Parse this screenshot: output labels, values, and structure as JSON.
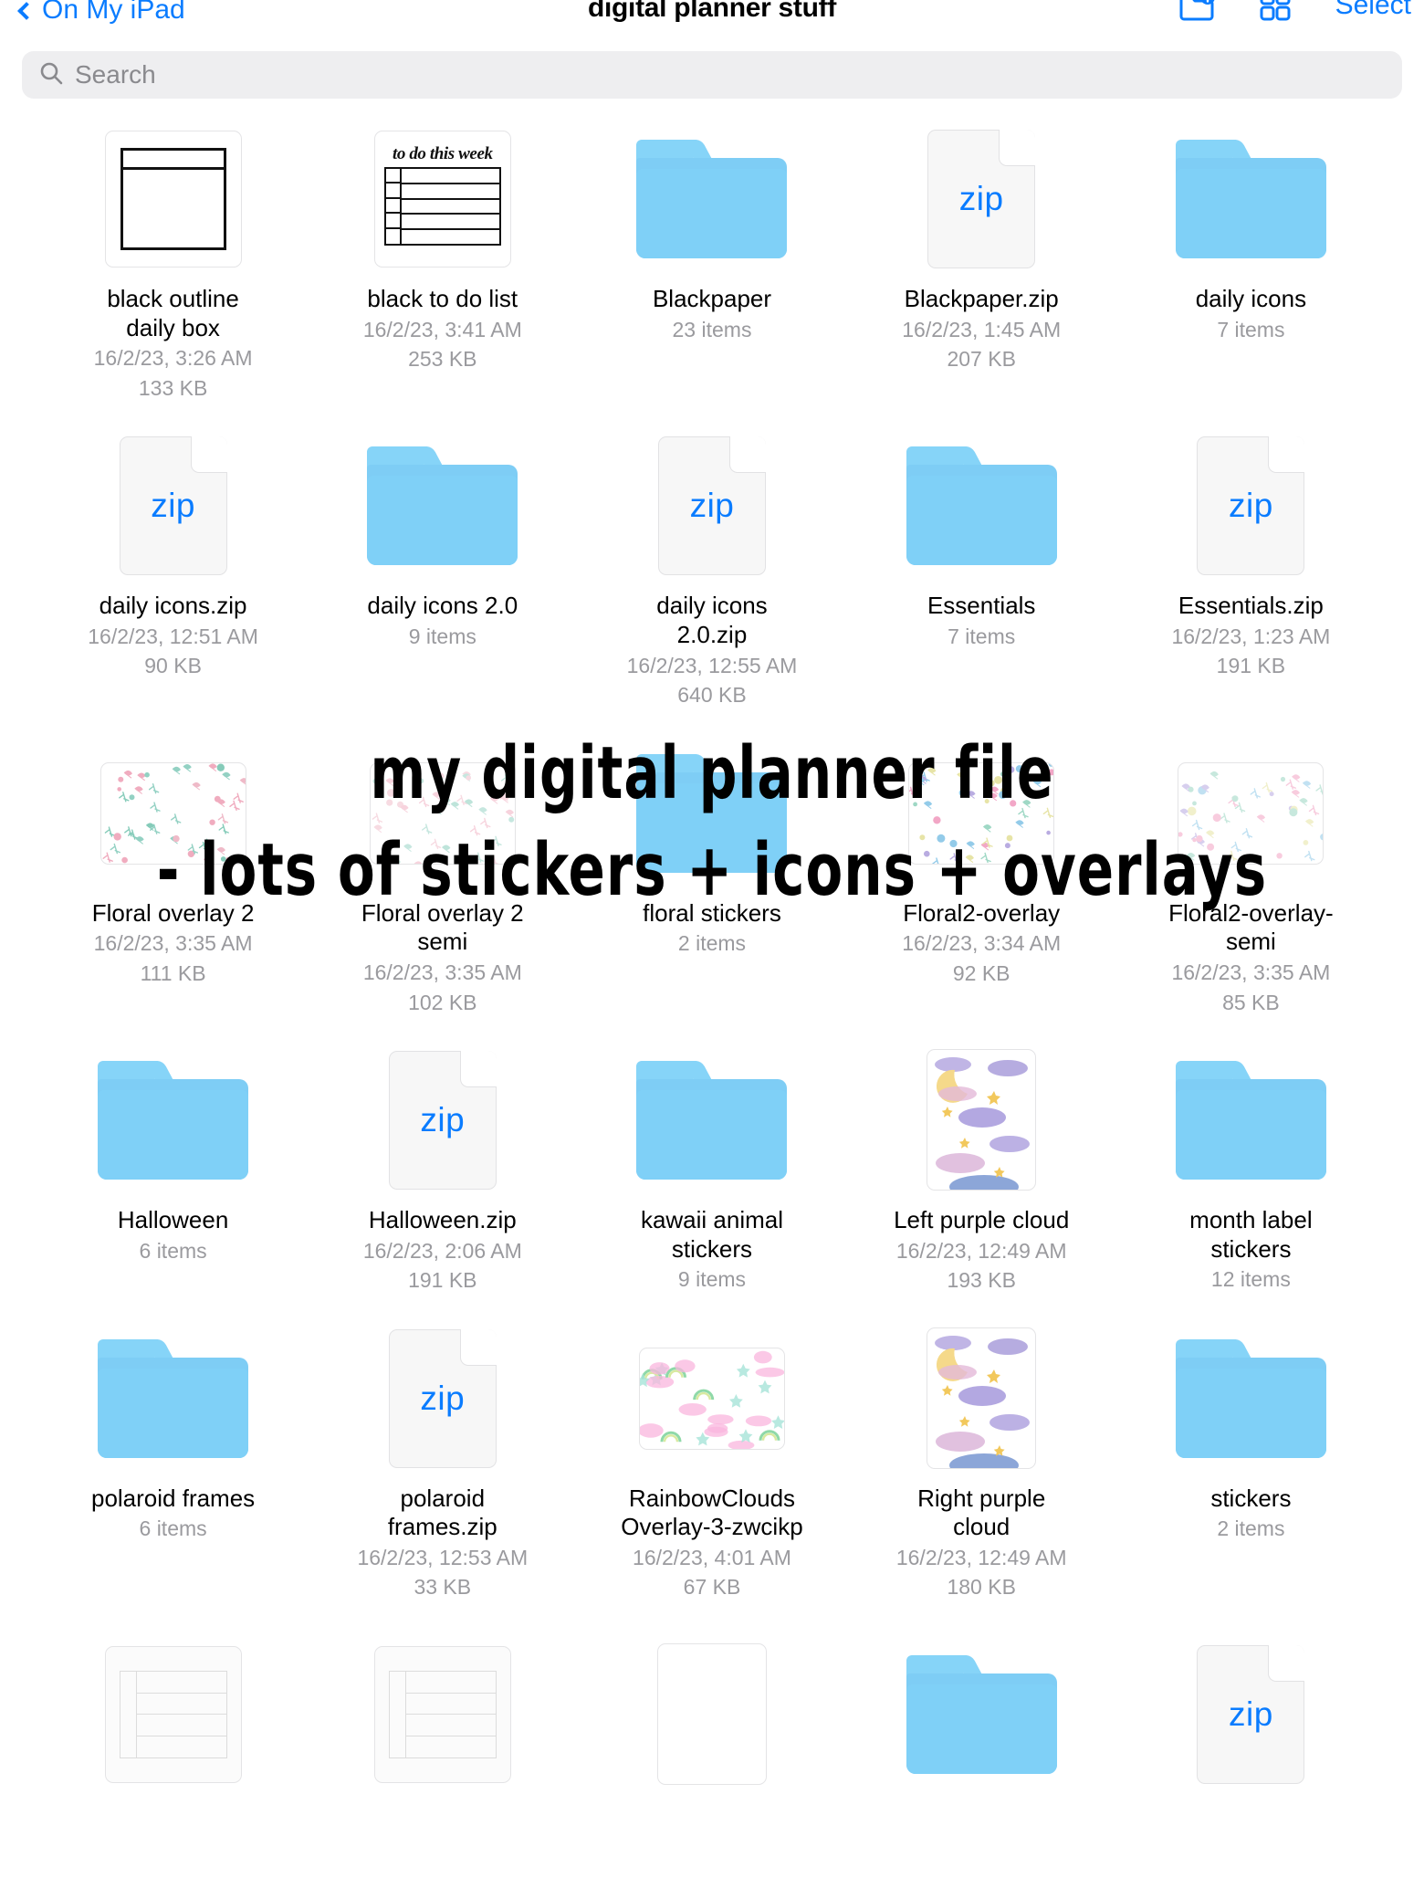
{
  "navbar": {
    "back_label": "On My iPad",
    "title": "digital planner stuff",
    "select_label": "Select",
    "new_folder_icon": "new-folder-icon",
    "grid_view_icon": "grid-view-icon",
    "accent_color": "#0a7cff"
  },
  "search": {
    "placeholder": "Search",
    "value": "",
    "icon": "search-icon"
  },
  "annotation": {
    "line1": "my digital planner file",
    "line2": "- lots of stickers + icons + overlays"
  },
  "colors": {
    "folder_blue": "#7fd0f7",
    "zip_blue": "#0a7cff",
    "meta_gray": "#9a9a9e"
  },
  "files": [
    {
      "name": "black outline daily box",
      "icon": "outline-box-thumbnail",
      "date": "16/2/23, 3:26 AM",
      "size": "133 KB",
      "items": ""
    },
    {
      "name": "black to do list",
      "icon": "todo-list-thumbnail",
      "date": "16/2/23, 3:41 AM",
      "size": "253 KB",
      "items": ""
    },
    {
      "name": "Blackpaper",
      "icon": "folder-icon",
      "date": "",
      "size": "",
      "items": "23 items"
    },
    {
      "name": "Blackpaper.zip",
      "icon": "zip-icon",
      "date": "16/2/23, 1:45 AM",
      "size": "207 KB",
      "items": ""
    },
    {
      "name": "daily icons",
      "icon": "folder-icon",
      "date": "",
      "size": "",
      "items": "7 items"
    },
    {
      "name": "daily icons.zip",
      "icon": "zip-icon",
      "date": "16/2/23, 12:51 AM",
      "size": "90 KB",
      "items": ""
    },
    {
      "name": "daily icons 2.0",
      "icon": "folder-icon",
      "date": "",
      "size": "",
      "items": "9 items"
    },
    {
      "name": "daily icons 2.0.zip",
      "icon": "zip-icon",
      "date": "16/2/23, 12:55 AM",
      "size": "640 KB",
      "items": ""
    },
    {
      "name": "Essentials",
      "icon": "folder-icon",
      "date": "",
      "size": "",
      "items": "7 items"
    },
    {
      "name": "Essentials.zip",
      "icon": "zip-icon",
      "date": "16/2/23, 1:23 AM",
      "size": "191 KB",
      "items": ""
    },
    {
      "name": "Floral overlay 2",
      "icon": "floral-pink-thumbnail",
      "date": "16/2/23, 3:35 AM",
      "size": "111 KB",
      "items": ""
    },
    {
      "name": "Floral overlay 2 semi",
      "icon": "floral-pink-faded-thumbnail",
      "date": "16/2/23, 3:35 AM",
      "size": "102 KB",
      "items": ""
    },
    {
      "name": "floral stickers",
      "icon": "folder-icon",
      "date": "",
      "size": "",
      "items": "2 items"
    },
    {
      "name": "Floral2-overlay",
      "icon": "floral-pastel-thumbnail",
      "date": "16/2/23, 3:34 AM",
      "size": "92 KB",
      "items": ""
    },
    {
      "name": "Floral2-overlay-semi",
      "icon": "floral-pastel-faded-thumbnail",
      "date": "16/2/23, 3:35 AM",
      "size": "85 KB",
      "items": ""
    },
    {
      "name": "Halloween",
      "icon": "folder-icon",
      "date": "",
      "size": "",
      "items": "6 items"
    },
    {
      "name": "Halloween.zip",
      "icon": "zip-icon",
      "date": "16/2/23, 2:06 AM",
      "size": "191 KB",
      "items": ""
    },
    {
      "name": "kawaii animal stickers",
      "icon": "folder-icon",
      "date": "",
      "size": "",
      "items": "9 items"
    },
    {
      "name": "Left purple cloud",
      "icon": "purple-cloud-thumbnail",
      "date": "16/2/23, 12:49 AM",
      "size": "193 KB",
      "items": ""
    },
    {
      "name": "month label stickers",
      "icon": "folder-icon",
      "date": "",
      "size": "",
      "items": "12 items"
    },
    {
      "name": "polaroid frames",
      "icon": "folder-icon",
      "date": "",
      "size": "",
      "items": "6 items"
    },
    {
      "name": "polaroid frames.zip",
      "icon": "zip-icon",
      "date": "16/2/23, 12:53 AM",
      "size": "33 KB",
      "items": ""
    },
    {
      "name": "RainbowCloudsOverlay-3-zwcikp",
      "icon": "rainbow-clouds-thumbnail",
      "date": "16/2/23, 4:01 AM",
      "size": "67 KB",
      "items": ""
    },
    {
      "name": "Right purple cloud",
      "icon": "purple-cloud-thumbnail",
      "date": "16/2/23, 12:49 AM",
      "size": "180 KB",
      "items": ""
    },
    {
      "name": "stickers",
      "icon": "folder-icon",
      "date": "",
      "size": "",
      "items": "2 items"
    }
  ],
  "partial_row": [
    {
      "icon": "table-doc-thumbnail"
    },
    {
      "icon": "table-doc-thumbnail"
    },
    {
      "icon": "blank-doc-thumbnail"
    },
    {
      "icon": "folder-icon"
    },
    {
      "icon": "zip-icon"
    }
  ]
}
